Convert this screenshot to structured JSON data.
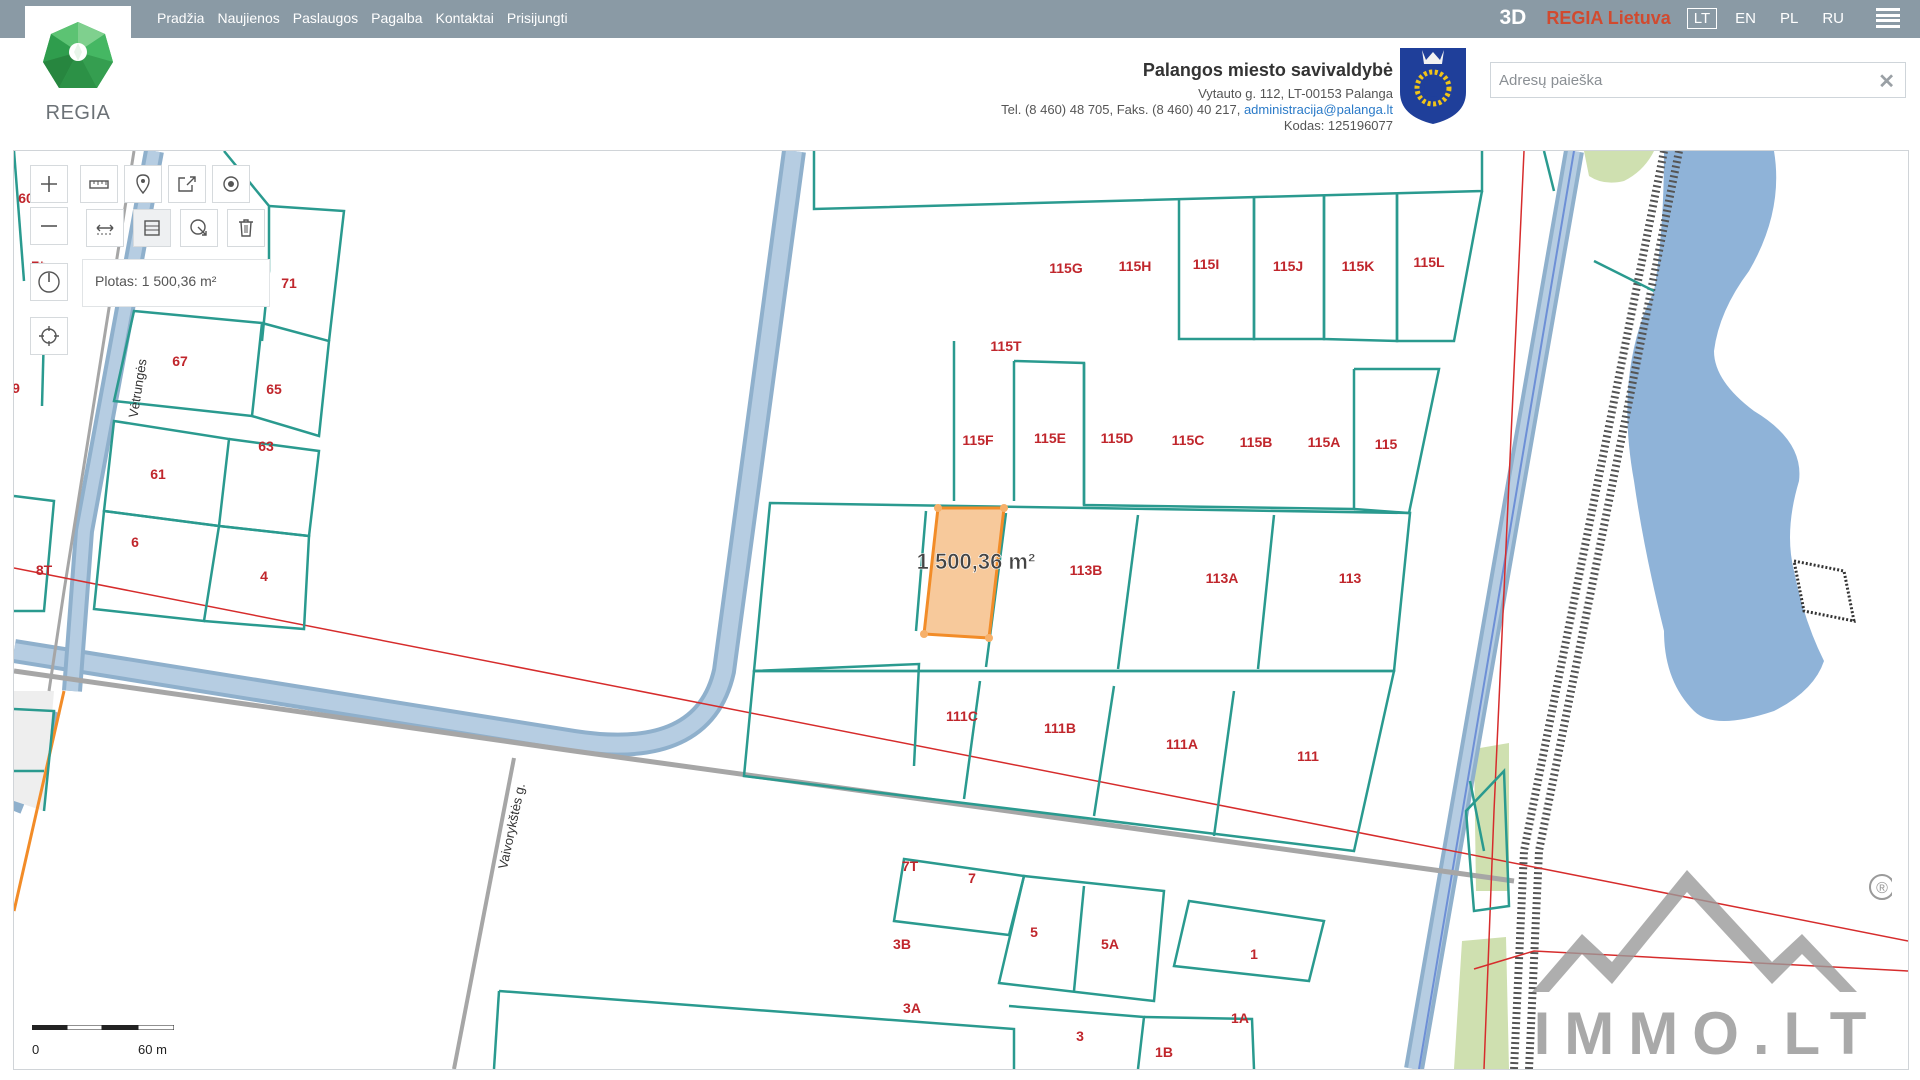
{
  "nav": {
    "items": [
      "Pradžia",
      "Naujienos",
      "Paslaugos",
      "Pagalba",
      "Kontaktai",
      "Prisijungti"
    ]
  },
  "brand": {
    "logo_text": "REGIA"
  },
  "header_tools": {
    "mode_3d": "3D",
    "regia_lietuva": "REGIA Lietuva",
    "languages": [
      "LT",
      "EN",
      "PL",
      "RU"
    ],
    "active_language": "LT"
  },
  "municipality": {
    "name": "Palangos miesto savivaldybė",
    "address": "Vytauto g. 112, LT-00153 Palanga",
    "phone": "Tel. (8 460) 48 705, Faks. (8 460) 40 217,",
    "email": "administracija@palanga.lt",
    "code": "Kodas: 125196077"
  },
  "search": {
    "placeholder": "Adresų paieška",
    "value": ""
  },
  "map": {
    "area_tooltip": "Plotas: 1 500,36 m²",
    "measurement_label": "1 500,36 m²",
    "scale": {
      "start": "0",
      "end": "60 m"
    },
    "streets": [
      "Vėtrungės",
      "Vaivorykštės g."
    ],
    "parcels": [
      "115G",
      "115H",
      "115I",
      "115J",
      "115K",
      "115L",
      "115T",
      "115F",
      "115E",
      "115D",
      "115C",
      "115B",
      "115A",
      "115",
      "113B",
      "113A",
      "113",
      "111C",
      "111B",
      "111A",
      "111",
      "7T",
      "7",
      "5",
      "5A",
      "1",
      "3B",
      "3A",
      "3",
      "1B",
      "1A",
      "71",
      "67",
      "65",
      "63",
      "61",
      "6",
      "4",
      "8T",
      "7*",
      "60",
      "9"
    ],
    "colors": {
      "parcel": "#2a9a8f",
      "label": "#c0262c",
      "road": "#9ab5cf",
      "highlight_fill": "#f6c08a",
      "highlight_stroke": "#f28c28",
      "water": "#8fb3d8"
    }
  },
  "watermark": {
    "text": "IMMO.LT",
    "registered": "®"
  },
  "icons": {
    "zoom_in": "plus-icon",
    "zoom_out": "minus-icon",
    "measure_length": "ruler-icon",
    "pin": "pin-icon",
    "share": "share-icon",
    "locate_point": "target-icon",
    "measure_distance": "distance-icon",
    "measure_area": "area-ruler-icon",
    "measure_clear": "eraser-icon",
    "delete": "trash-icon",
    "rotate": "compass-icon",
    "gps": "crosshair-icon"
  }
}
